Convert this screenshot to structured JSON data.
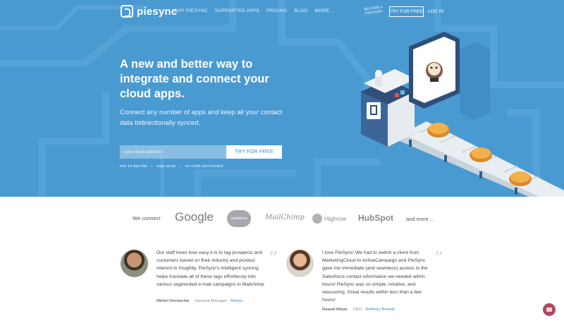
{
  "brand": {
    "name": "piesync"
  },
  "nav": {
    "links": [
      "WHY PIESYNC",
      "SUPPORTED APPS",
      "PRICING",
      "BLOG",
      "MORE..."
    ],
    "partner": "BECOME A PARTNER!",
    "try_free": "TRY FOR FREE",
    "login": "LOG IN"
  },
  "hero": {
    "headline": "A new and better way to integrate and connect your cloud apps.",
    "subline": "Connect any number of apps and keep all your contact data bidirectionally synced.",
    "email_placeholder": "your email address",
    "cta": "TRY FOR FREE",
    "notes": [
      "free 14-day trial",
      "easy setup",
      "no credit card needed"
    ]
  },
  "logos": {
    "lead": "We connect",
    "items": [
      "Google",
      "salesforce",
      "MailChimp",
      "Highrise",
      "HubSpot"
    ],
    "trail": "and more ..."
  },
  "testimonials": [
    {
      "text": "Our staff loves how easy it is to tag prospects and customers based on their industry and product interest in Insightly. PieSync's intelligent syncing helps translate all of these tags effortlessly into various segmented e-mail campaigns in Mailchimp.",
      "name": "Michel Devisscher",
      "role": "General Manager - ",
      "company": "Medys"
    },
    {
      "text": "I love PieSync! We had to switch a client from MarketingCloud to ActiveCampaign and PieSync gave me immediate (and seamless) access to the Salesforce contact information we needed within hours! PieSync was so simple, intuitive, and reassuring. Great results within less than a few hours!",
      "name": "Raquel Moyer",
      "role": "CEO - ",
      "company": "Refinery Brands"
    }
  ],
  "colors": {
    "hero_bg": "#4a9ad2",
    "accent": "#3c8bc8"
  }
}
